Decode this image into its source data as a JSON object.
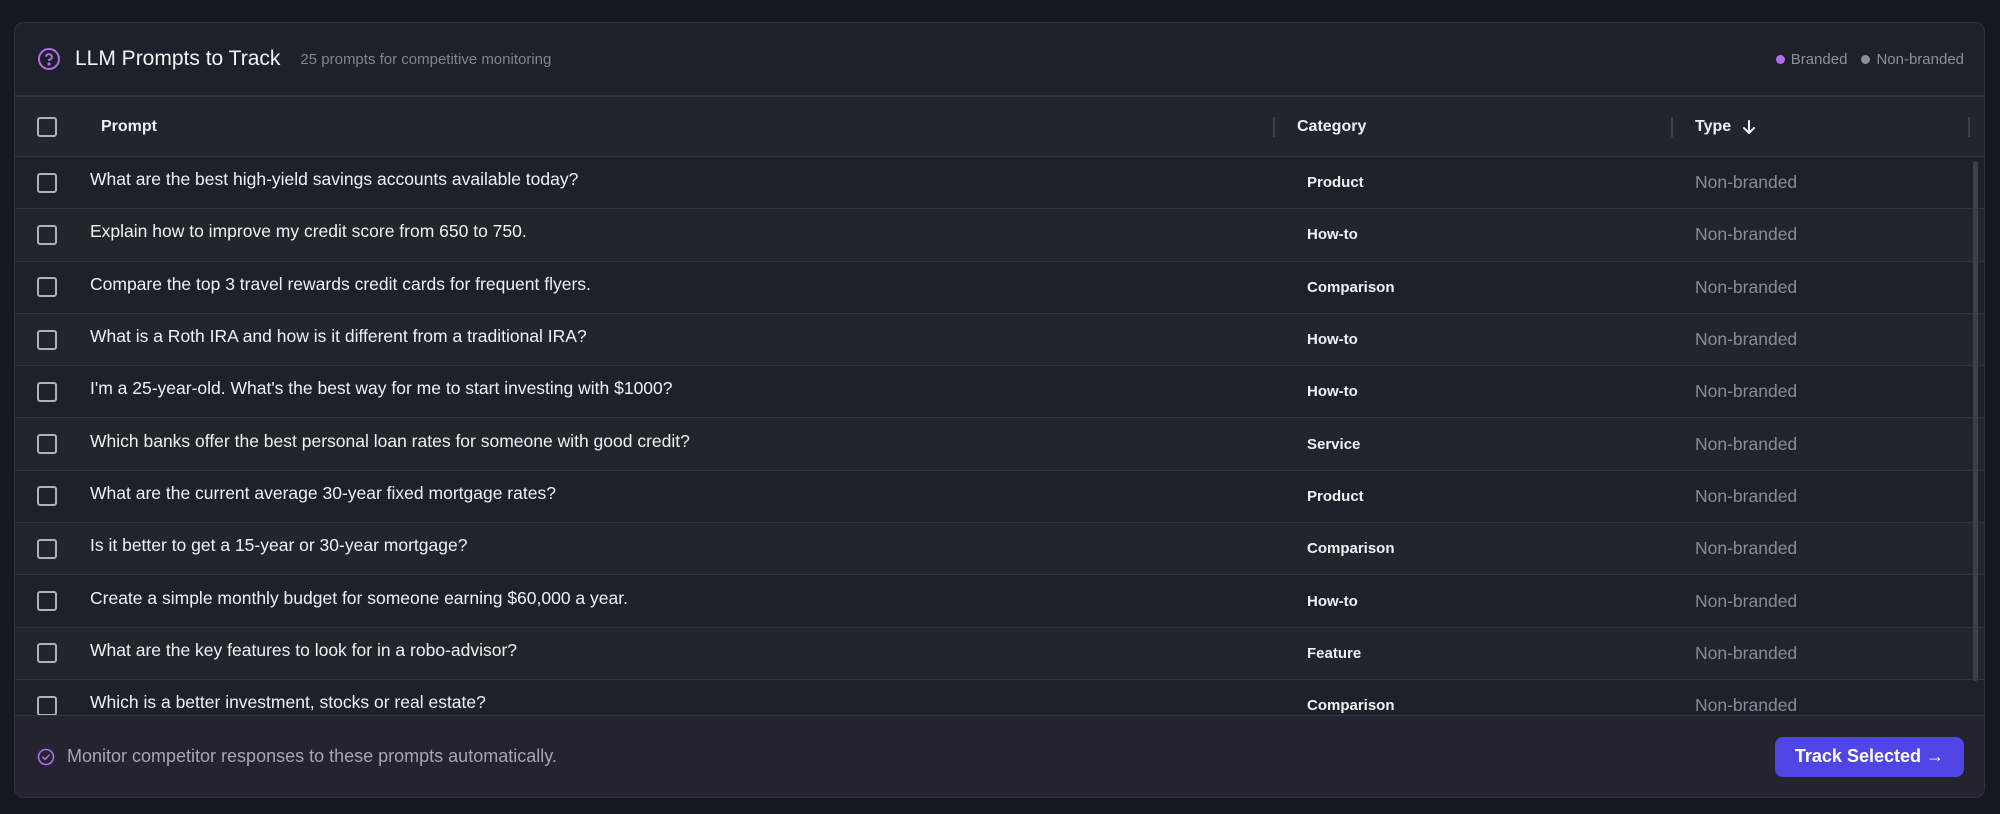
{
  "header": {
    "title": "LLM Prompts to Track",
    "subtitle": "25 prompts for competitive monitoring",
    "legend": [
      {
        "label": "Branded",
        "color": "#b36ce8"
      },
      {
        "label": "Non-branded",
        "color": "#8b8f96"
      }
    ]
  },
  "table": {
    "columns": {
      "prompt": "Prompt",
      "category": "Category",
      "type": "Type"
    },
    "sort_icon": "arrow-down-icon",
    "rows": [
      {
        "prompt": "What are the best high-yield savings accounts available today?",
        "category": "Product",
        "type": "Non-branded"
      },
      {
        "prompt": "Explain how to improve my credit score from 650 to 750.",
        "category": "How-to",
        "type": "Non-branded"
      },
      {
        "prompt": "Compare the top 3 travel rewards credit cards for frequent flyers.",
        "category": "Comparison",
        "type": "Non-branded"
      },
      {
        "prompt": "What is a Roth IRA and how is it different from a traditional IRA?",
        "category": "How-to",
        "type": "Non-branded"
      },
      {
        "prompt": "I'm a 25-year-old. What's the best way for me to start investing with $1000?",
        "category": "How-to",
        "type": "Non-branded"
      },
      {
        "prompt": "Which banks offer the best personal loan rates for someone with good credit?",
        "category": "Service",
        "type": "Non-branded"
      },
      {
        "prompt": "What are the current average 30-year fixed mortgage rates?",
        "category": "Product",
        "type": "Non-branded"
      },
      {
        "prompt": "Is it better to get a 15-year or 30-year mortgage?",
        "category": "Comparison",
        "type": "Non-branded"
      },
      {
        "prompt": "Create a simple monthly budget for someone earning $60,000 a year.",
        "category": "How-to",
        "type": "Non-branded"
      },
      {
        "prompt": "What are the key features to look for in a robo-advisor?",
        "category": "Feature",
        "type": "Non-branded"
      },
      {
        "prompt": "Which is a better investment, stocks or real estate?",
        "category": "Comparison",
        "type": "Non-branded"
      }
    ]
  },
  "footer": {
    "text": "Monitor competitor responses to these prompts automatically.",
    "button_label": "Track Selected →"
  },
  "colors": {
    "accent": "#4f46e5",
    "icon_purple": "#b36ce8"
  }
}
